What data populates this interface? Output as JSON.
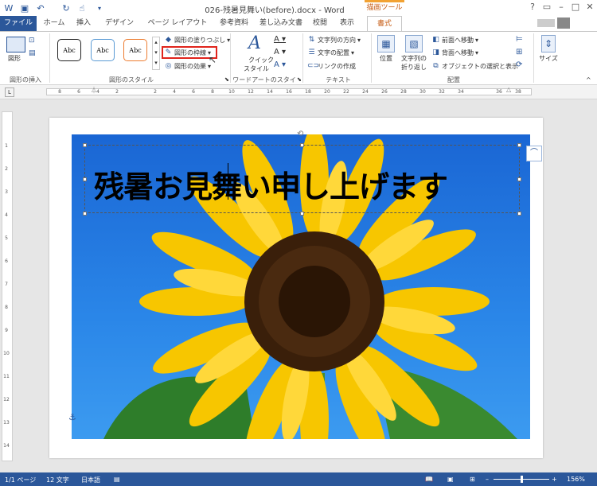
{
  "titlebar": {
    "title": "026-残暑見舞い(before).docx - Word",
    "context_tools": "描画ツール"
  },
  "tabs": {
    "file": "ファイル",
    "home": "ホーム",
    "insert": "挿入",
    "design": "デザイン",
    "layout": "ページ レイアウト",
    "references": "参考資料",
    "mailings": "差し込み文書",
    "review": "校閲",
    "view": "表示",
    "format": "書式"
  },
  "ribbon": {
    "insert_shapes": {
      "shape_label": "図形",
      "group": "図形の挿入"
    },
    "shape_styles": {
      "samples": [
        "Abc",
        "Abc",
        "Abc"
      ],
      "fill": "図形の塗りつぶし",
      "outline": "図形の枠線",
      "effects": "図形の効果",
      "group": "図形のスタイル"
    },
    "wordart": {
      "quick": "クイック",
      "style": "スタイル",
      "group": "ワードアートのスタイル"
    },
    "text": {
      "direction": "文字列の方向",
      "align": "文字の配置",
      "link": "リンクの作成",
      "group": "テキスト"
    },
    "arrange": {
      "position": "位置",
      "wrap1": "文字列の",
      "wrap2": "折り返し",
      "forward": "前面へ移動",
      "backward": "背面へ移動",
      "selection": "オブジェクトの選択と表示",
      "group": "配置"
    },
    "size": {
      "label": "サイズ"
    }
  },
  "document": {
    "textbox_text": "残暑お見舞い申し上げます"
  },
  "ruler": {
    "ticks": [
      "8",
      "6",
      "4",
      "2",
      "",
      "2",
      "4",
      "6",
      "8",
      "10",
      "12",
      "14",
      "16",
      "18",
      "20",
      "22",
      "24",
      "26",
      "28",
      "30",
      "32",
      "34",
      "",
      "36",
      "38"
    ]
  },
  "vruler": {
    "ticks": [
      "1",
      "2",
      "3",
      "4",
      "5",
      "6",
      "7",
      "8",
      "9",
      "10",
      "11",
      "12",
      "13",
      "14"
    ]
  },
  "status": {
    "page": "1/1 ページ",
    "words": "12 文字",
    "language": "日本語",
    "zoom": "156%"
  },
  "colors": {
    "accent": "#2b579a",
    "highlight": "#e0241c",
    "context": "#f2a233"
  }
}
